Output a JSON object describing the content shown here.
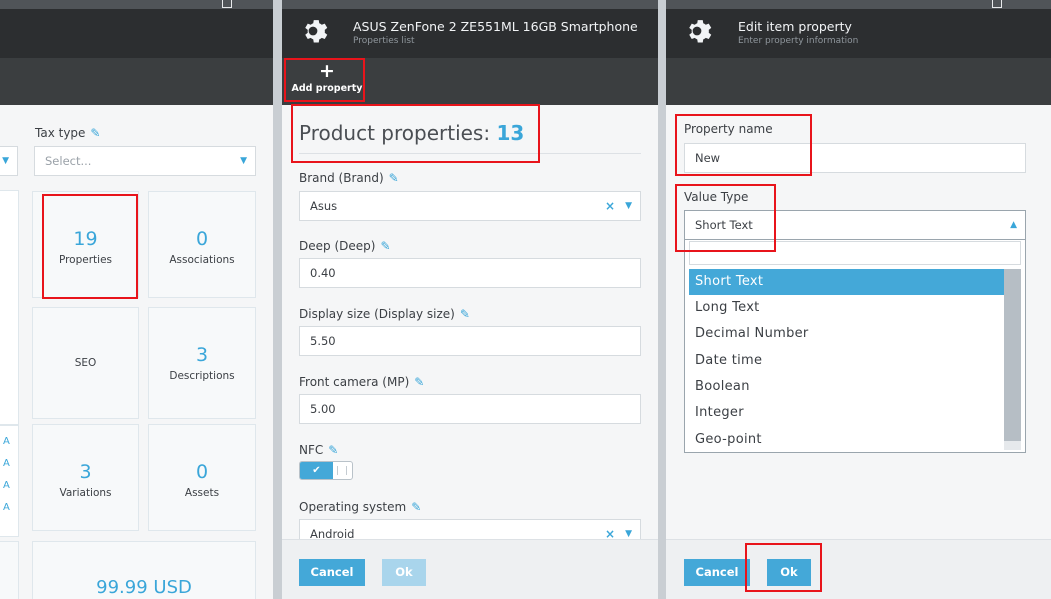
{
  "panel_left": {
    "tax_type_label": "Tax type",
    "tax_type_placeholder": "Select...",
    "tiles": [
      {
        "value": "19",
        "label": "Properties"
      },
      {
        "value": "0",
        "label": "Associations"
      },
      {
        "value": "",
        "label": "SEO"
      },
      {
        "value": "3",
        "label": "Descriptions"
      },
      {
        "value": "3",
        "label": "Variations"
      },
      {
        "value": "0",
        "label": "Assets"
      }
    ],
    "price": "99.99 USD",
    "edge_letters": [
      "A",
      "A",
      "A",
      "A"
    ]
  },
  "panel_middle": {
    "title": "ASUS ZenFone 2 ZE551ML 16GB Smartphone",
    "subtitle": "Properties list",
    "add_property_label": "Add property",
    "section_heading": "Product properties:",
    "property_count": "13",
    "properties": [
      {
        "label": "Brand (Brand)",
        "value": "Asus"
      },
      {
        "label": "Deep (Deep)",
        "value": "0.40"
      },
      {
        "label": "Display size (Display size)",
        "value": "5.50"
      },
      {
        "label": "Front camera (MP)",
        "value": "5.00"
      },
      {
        "label": "NFC",
        "value": "true"
      },
      {
        "label": "Operating system",
        "value": "Android"
      }
    ],
    "cancel_label": "Cancel",
    "ok_label": "Ok"
  },
  "panel_right": {
    "title": "Edit item property",
    "subtitle": "Enter property information",
    "property_name_label": "Property name",
    "property_name_value": "New",
    "value_type_label": "Value Type",
    "value_type_selected": "Short Text",
    "value_type_options": [
      "Short Text",
      "Long Text",
      "Decimal Number",
      "Date time",
      "Boolean",
      "Integer",
      "Geo-point"
    ],
    "cancel_label": "Cancel",
    "ok_label": "Ok"
  },
  "colors": {
    "accent": "#44a8d8",
    "header": "#2c2e30",
    "highlight": "#e8141b"
  }
}
